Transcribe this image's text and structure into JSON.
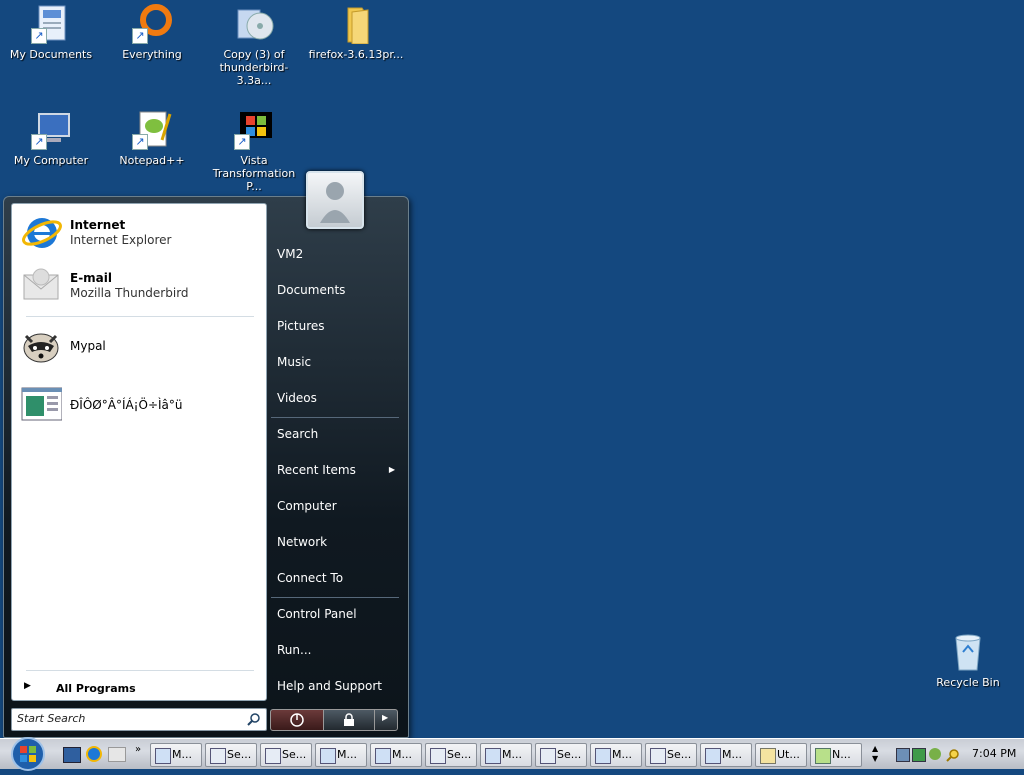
{
  "desktop": {
    "icons": [
      {
        "label": "My Documents",
        "icon": "my-documents-icon"
      },
      {
        "label": "Everything",
        "icon": "everything-icon"
      },
      {
        "label": "Copy (3) of thunderbird-3.3a...",
        "icon": "installer-icon"
      },
      {
        "label": "firefox-3.6.13pr...",
        "icon": "folder-icon"
      },
      {
        "label": "My Computer",
        "icon": "my-computer-icon"
      },
      {
        "label": "Notepad++",
        "icon": "notepadpp-icon"
      },
      {
        "label": "Vista Transformation P...",
        "icon": "vista-transformation-icon"
      },
      {
        "label": "Recycle Bin",
        "icon": "recycle-bin-icon"
      }
    ]
  },
  "start_menu": {
    "pinned": [
      {
        "title": "Internet",
        "subtitle": "Internet Explorer"
      },
      {
        "title": "E-mail",
        "subtitle": "Mozilla Thunderbird"
      }
    ],
    "recent": [
      {
        "label": "Mypal"
      },
      {
        "label": "ÐÎÔØ°Â°ÍÁ¡Ö÷Ìâ°ü"
      }
    ],
    "all_programs": "All Programs",
    "search_placeholder": "Start Search",
    "right_items": [
      "VM2",
      "Documents",
      "Pictures",
      "Music",
      "Videos",
      "Search",
      "Recent Items",
      "Computer",
      "Network",
      "Connect To",
      "Control Panel",
      "Run...",
      "Help and Support"
    ]
  },
  "taskbar": {
    "tasks": [
      "M...",
      "Se...",
      "Se...",
      "M...",
      "M...",
      "Se...",
      "M...",
      "Se...",
      "M...",
      "Se...",
      "M...",
      "Ut...",
      "N..."
    ],
    "clock": "7:04 PM"
  },
  "colors": {
    "desktop": "#14487f",
    "menu_dark": "#101921",
    "accent": "#1a5fc8"
  }
}
